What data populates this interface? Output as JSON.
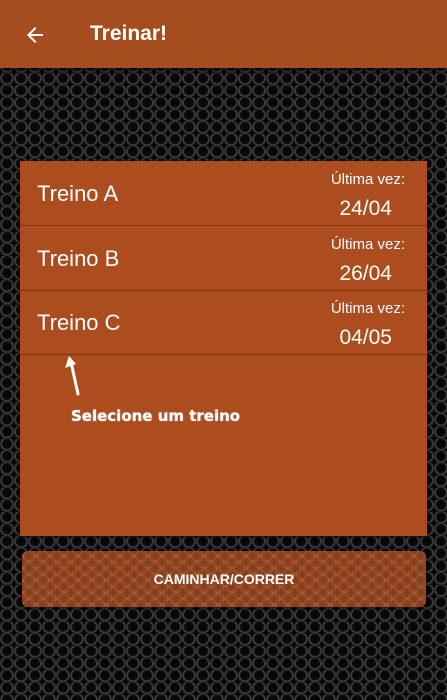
{
  "appbar": {
    "title": "Treinar!",
    "back_icon": "arrow-left-icon",
    "color": "#a64d20"
  },
  "workouts": [
    {
      "name": "Treino A",
      "last_label": "Última vez:",
      "last_date": "24/04"
    },
    {
      "name": "Treino B",
      "last_label": "Última vez:",
      "last_date": "26/04"
    },
    {
      "name": "Treino C",
      "last_label": "Última vez:",
      "last_date": "04/05"
    }
  ],
  "hint": {
    "icon": "arrow-up-icon",
    "text": "Selecione um treino"
  },
  "walk_button": {
    "label": "CAMINHAR/CORRER"
  },
  "colors": {
    "accent": "#ad4d1f",
    "divider": "#7b3415",
    "text": "#ffffff"
  }
}
